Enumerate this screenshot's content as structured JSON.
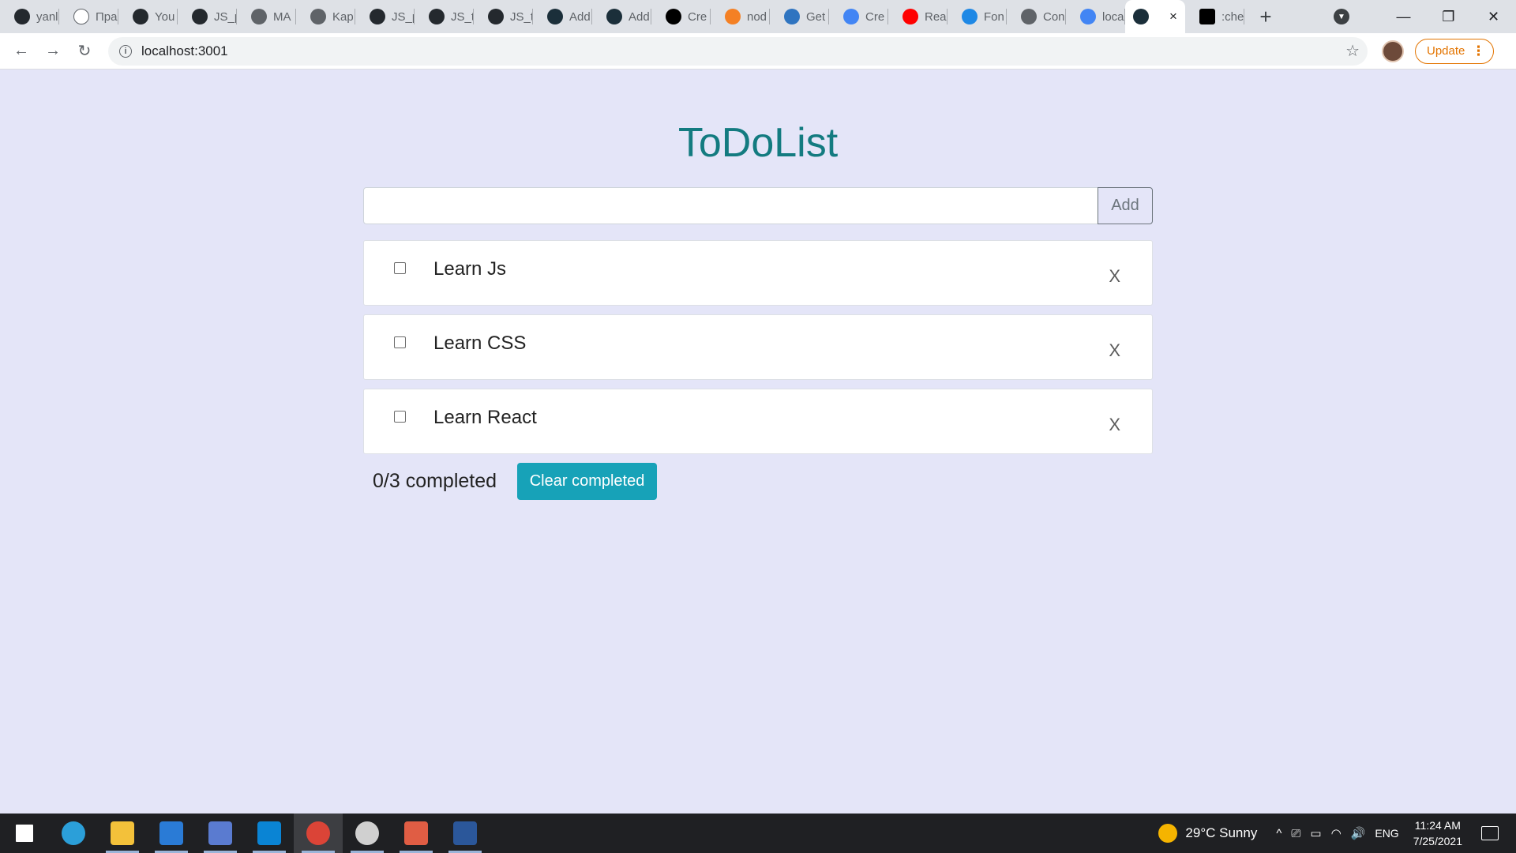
{
  "browser": {
    "tabs": [
      {
        "title": "yanl",
        "favicon_color": "#24292e"
      },
      {
        "title": "Пра",
        "favicon_color": "#ffffff"
      },
      {
        "title": "You",
        "favicon_color": "#24292e"
      },
      {
        "title": "JS_p",
        "favicon_color": "#24292e"
      },
      {
        "title": "MA",
        "favicon_color": "#5f6368"
      },
      {
        "title": "Kap",
        "favicon_color": "#5f6368"
      },
      {
        "title": "JS_p",
        "favicon_color": "#24292e"
      },
      {
        "title": "JS_t",
        "favicon_color": "#24292e"
      },
      {
        "title": "JS_t",
        "favicon_color": "#24292e"
      },
      {
        "title": "Add",
        "favicon_color": "#1b2f3a"
      },
      {
        "title": "Add",
        "favicon_color": "#1b2f3a"
      },
      {
        "title": "Cre",
        "favicon_color": "#000000"
      },
      {
        "title": "nod",
        "favicon_color": "#f48024"
      },
      {
        "title": "Get",
        "favicon_color": "#2f74c0"
      },
      {
        "title": "Cre",
        "favicon_color": "#4285f4"
      },
      {
        "title": "Rea",
        "favicon_color": "#ff0000"
      },
      {
        "title": "Fon",
        "favicon_color": "#1e88e5"
      },
      {
        "title": "Con",
        "favicon_color": "#5f6368"
      },
      {
        "title": "loca",
        "favicon_color": "#4285f4"
      }
    ],
    "active_tab": {
      "favicon_color": "#1b2f3a",
      "close_icon": "×"
    },
    "last_tab": {
      "title": ":che",
      "favicon_color": "#000000"
    },
    "new_tab_icon": "+",
    "window_controls": {
      "minimize": "—",
      "restore": "❐",
      "close": "✕"
    },
    "address": "localhost:3001",
    "update_label": "Update",
    "update_menu": "⋮",
    "bookmark_icon": "☆",
    "back_icon": "←",
    "forward_icon": "→",
    "reload_icon": "↻",
    "info_icon": "i"
  },
  "app": {
    "title": "ToDoList",
    "add_input_value": "",
    "add_button_label": "Add",
    "todos": [
      {
        "text": "Learn Js",
        "completed": false,
        "delete_label": "X"
      },
      {
        "text": "Learn CSS",
        "completed": false,
        "delete_label": "X"
      },
      {
        "text": "Learn React",
        "completed": false,
        "delete_label": "X"
      }
    ],
    "completed_text": "0/3 completed",
    "clear_button_label": "Clear completed",
    "colors": {
      "title": "#137b80",
      "clear_button": "#17a2b8",
      "background": "#e4e5f8"
    }
  },
  "taskbar": {
    "apps": [
      {
        "name": "start-icon",
        "color": "#ffffff"
      },
      {
        "name": "edge-icon",
        "color": "#2b9fd9"
      },
      {
        "name": "file-explorer-icon",
        "color": "#f3c13a"
      },
      {
        "name": "mail-icon",
        "color": "#2a7bd6"
      },
      {
        "name": "remote-desktop-icon",
        "color": "#5a7bd0"
      },
      {
        "name": "vscode-icon",
        "color": "#0a84d4"
      },
      {
        "name": "chrome-icon",
        "color": "#db4437"
      },
      {
        "name": "github-desktop-icon",
        "color": "#d0d0d0"
      },
      {
        "name": "git-icon",
        "color": "#e05d44"
      },
      {
        "name": "word-icon",
        "color": "#2b579a"
      }
    ],
    "weather": "29°C  Sunny",
    "tray_symbols": [
      "^",
      "⎚",
      "▭",
      "◠",
      "🔊"
    ],
    "language": "ENG",
    "time": "11:24 AM",
    "date": "7/25/2021"
  }
}
